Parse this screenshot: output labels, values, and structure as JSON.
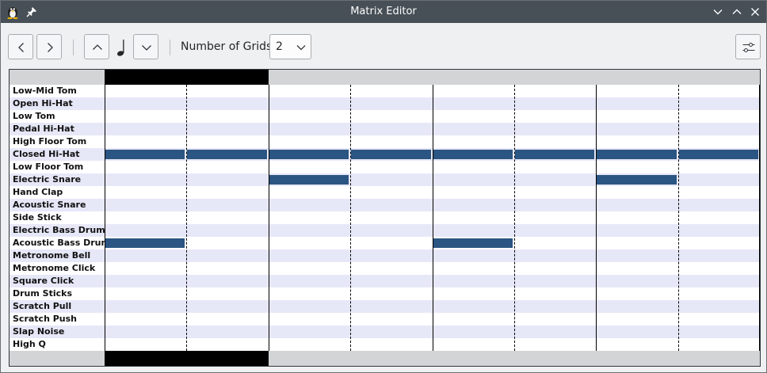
{
  "window": {
    "title": "Matrix Editor"
  },
  "toolbar": {
    "grids_label": "Number of Grids:",
    "grids_value": "2"
  },
  "matrix": {
    "columns": 8,
    "instruments": [
      "Low-Mid Tom",
      "Open Hi-Hat",
      "Low Tom",
      "Pedal Hi-Hat",
      "High Floor Tom",
      "Closed Hi-Hat",
      "Low Floor Tom",
      "Electric Snare",
      "Hand Clap",
      "Acoustic Snare",
      "Side Stick",
      "Electric Bass Drum",
      "Acoustic Bass Drum",
      "Metronome Bell",
      "Metronome Click",
      "Square Click",
      "Drum Sticks",
      "Scratch Pull",
      "Scratch Push",
      "Slap Noise",
      "High Q"
    ],
    "active_cells": {
      "Closed Hi-Hat": [
        0,
        1,
        2,
        3,
        4,
        5,
        6,
        7
      ],
      "Electric Snare": [
        2,
        6
      ],
      "Acoustic Bass Drum": [
        0,
        4
      ]
    },
    "current_grid": 1,
    "grid_count": 4
  },
  "colors": {
    "row_alt": "#e6e8f8",
    "note": "#2b5582",
    "current_marker": "#000000",
    "header_bg": "#d3d4d5"
  }
}
